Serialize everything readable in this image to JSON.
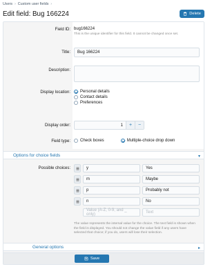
{
  "breadcrumb": [
    "Users",
    "Custom user fields"
  ],
  "page_title": "Edit field: Bug 166224",
  "delete_label": "Delete",
  "field_id": {
    "label": "Field ID:",
    "value": "bug166224",
    "hint": "This is the unique identifier for this field. It cannot be changed once set."
  },
  "title": {
    "label": "Title:",
    "value": "Bug 166224"
  },
  "description": {
    "label": "Description:",
    "value": ""
  },
  "display_location": {
    "label": "Display location:",
    "options": [
      "Personal details",
      "Contact details",
      "Preferences"
    ],
    "selected": "Personal details"
  },
  "display_order": {
    "label": "Display order:",
    "value": "1",
    "plus": "+",
    "minus": "−"
  },
  "field_type": {
    "label": "Field type:",
    "options": [
      "Check boxes",
      "Multiple-choice drop down"
    ],
    "selected": "Multiple-choice drop down"
  },
  "choice_section": {
    "title": "Options for choice fields"
  },
  "possible_choices": {
    "label": "Possible choices:",
    "rows": [
      {
        "value": "y",
        "text": "Yes"
      },
      {
        "value": "m",
        "text": "Maybe"
      },
      {
        "value": "p",
        "text": "Probably not"
      },
      {
        "value": "n",
        "text": "No"
      }
    ],
    "value_placeholder": "Value (A-Z, 0-9, and _ only)",
    "text_placeholder": "Text",
    "hint": "The value represents the internal value for the choice. The text field is shown when the field is displayed. You should not change the value field if any users have selected that choice; if you do, users will lose their selection."
  },
  "general_section": {
    "title": "General options"
  },
  "save_label": "Save",
  "colors": {
    "accent": "#2577b1",
    "panel": "#f5f5f5",
    "border": "#dfe5eb"
  }
}
